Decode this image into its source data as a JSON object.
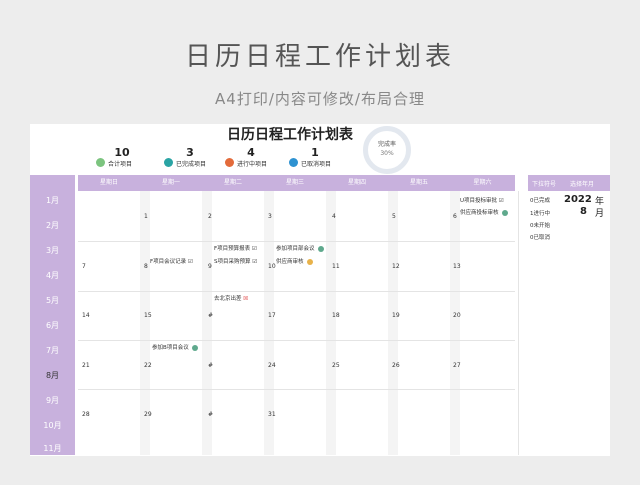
{
  "page": {
    "title": "日历日程工作计划表",
    "subtitle": "A4打印/内容可修改/布局合理"
  },
  "sheet": {
    "title": "日历日程工作计划表",
    "stats": [
      {
        "num": "10",
        "label": "合计项目",
        "icon_color": "#7cc47f"
      },
      {
        "num": "3",
        "label": "已完成项目",
        "icon_color": "#2aa4a4"
      },
      {
        "num": "4",
        "label": "进行中项目",
        "icon_color": "#e36b3b"
      },
      {
        "num": "1",
        "label": "已取消项目",
        "icon_color": "#2e92d1"
      }
    ],
    "donut": {
      "label": "完成率",
      "value": "30%"
    }
  },
  "months": [
    "1月",
    "2月",
    "3月",
    "4月",
    "5月",
    "6月",
    "7月",
    "8月",
    "9月",
    "10月",
    "11月"
  ],
  "current_month": "8月",
  "weekdays": [
    "星期日",
    "星期一",
    "星期二",
    "星期三",
    "星期四",
    "星期五",
    "星期六"
  ],
  "side": {
    "head_left": "下拉符号",
    "head_right": "选择年月",
    "year": "2022",
    "year_unit": "年",
    "month": "8",
    "month_unit": "月",
    "legend": [
      "0已完成",
      "1进行中",
      "0未开始",
      "0已取消"
    ]
  },
  "days": [
    [
      "",
      "1",
      "2",
      "3",
      "4",
      "5",
      "6"
    ],
    [
      "7",
      "8",
      "9",
      "10",
      "11",
      "12",
      "13"
    ],
    [
      "14",
      "15",
      "#",
      "17",
      "18",
      "19",
      "20"
    ],
    [
      "21",
      "22",
      "#",
      "24",
      "25",
      "26",
      "27"
    ],
    [
      "28",
      "29",
      "#",
      "31",
      "",
      "",
      ""
    ]
  ],
  "events": [
    {
      "text": "U项目投标审批",
      "mark": "☑",
      "color": ""
    },
    {
      "text": "供应商投标审核",
      "mark": "",
      "color": "#5fa98d"
    },
    {
      "text": "F项目预算报表",
      "mark": "☑",
      "color": ""
    },
    {
      "text": "S项目采购预算",
      "mark": "☑",
      "color": ""
    },
    {
      "text": "参加项目部会议",
      "mark": "",
      "color": "#5fa98d"
    },
    {
      "text": "供应商审核",
      "mark": "",
      "color": "#e8b24a"
    },
    {
      "text": "F项目会议记录",
      "mark": "☑",
      "color": ""
    },
    {
      "text": "去北京出差",
      "mark": "☒",
      "color": ""
    },
    {
      "text": "参加B项目会议",
      "mark": "",
      "color": "#5fa98d"
    }
  ]
}
